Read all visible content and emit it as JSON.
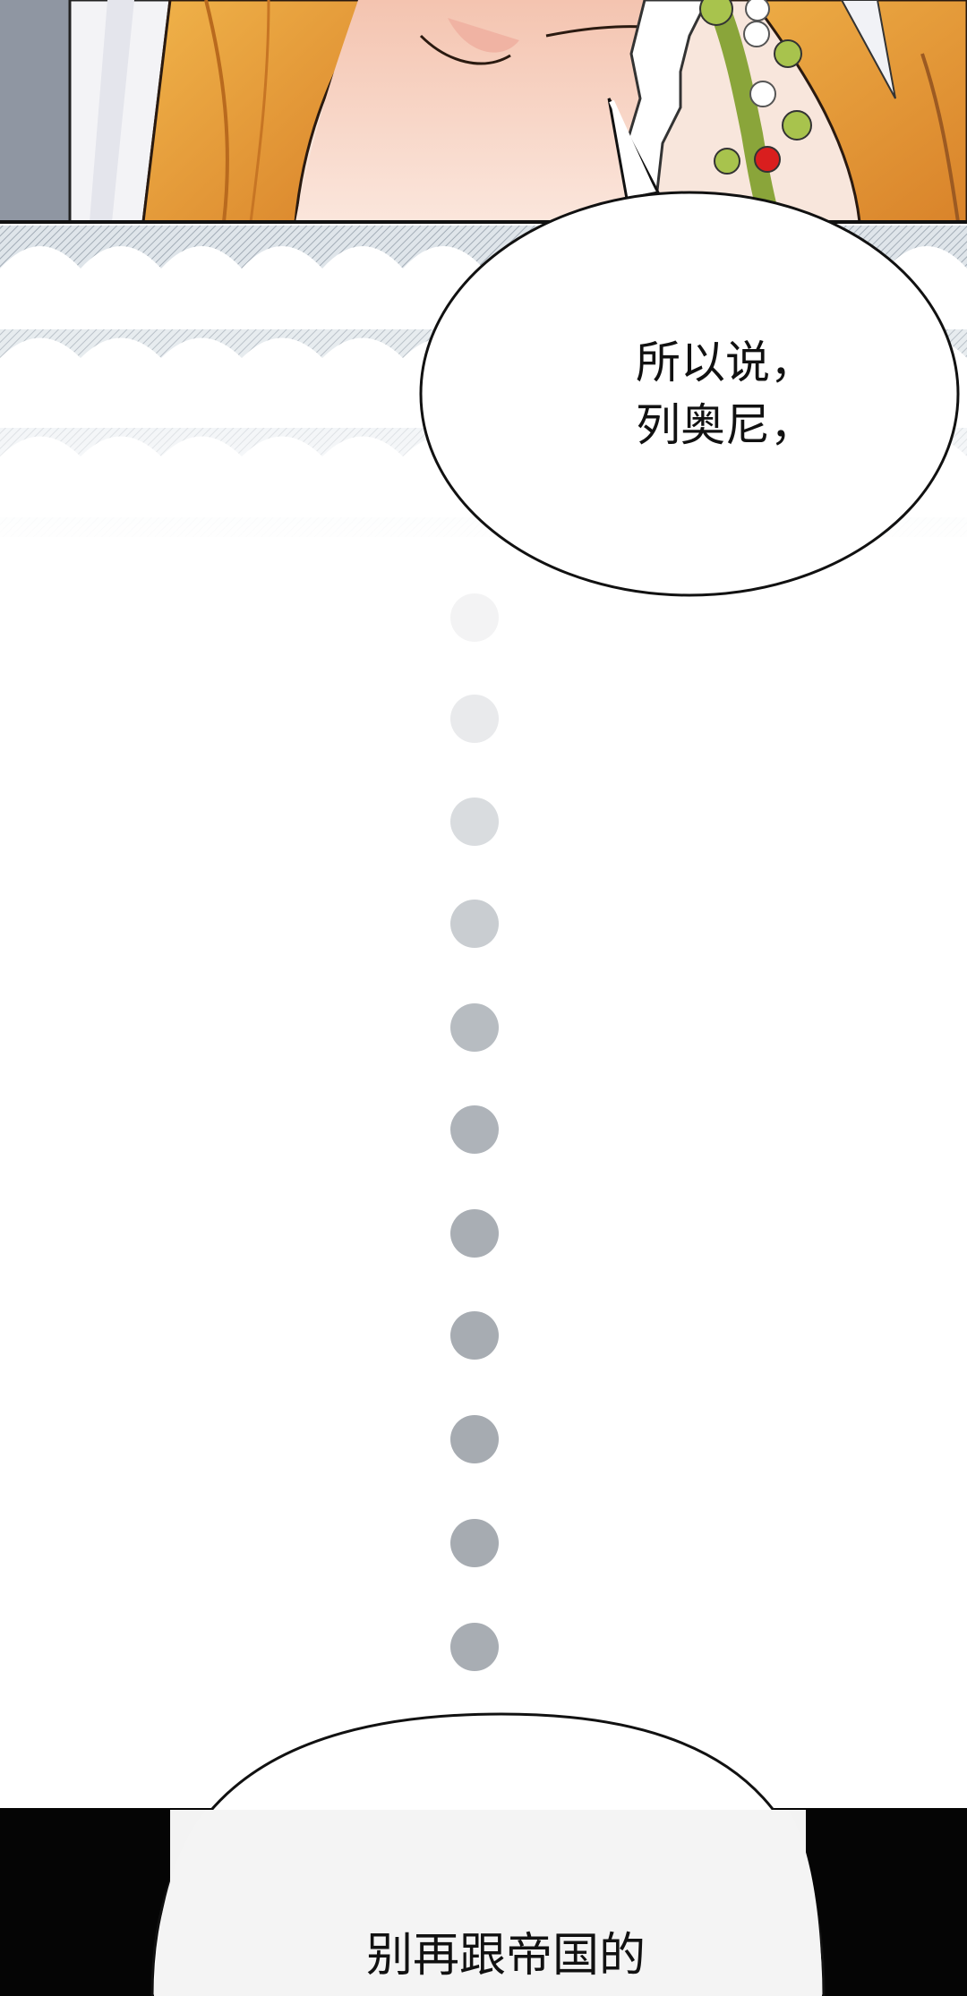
{
  "comic": {
    "speech_bubbles": [
      {
        "lines": [
          "所以说，",
          "列奥尼，"
        ]
      },
      {
        "lines": [
          "别再跟帝国的"
        ]
      }
    ]
  },
  "colors": {
    "hair": "#e8a23c",
    "skin": "#f9d7c3",
    "background_lace": "#a9b3bd",
    "dots": "#a6acb3",
    "bottom_panel": "#050505"
  }
}
